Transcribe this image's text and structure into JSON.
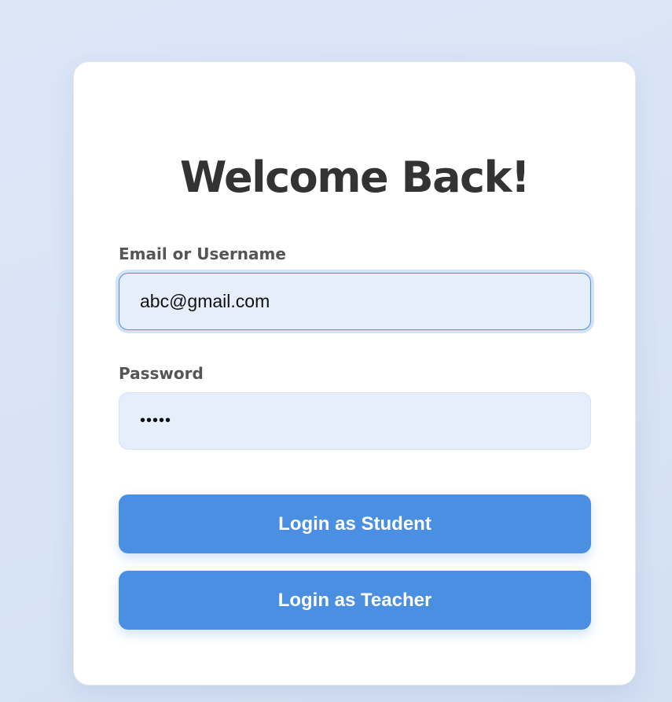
{
  "login": {
    "title": "Welcome Back!",
    "email_label": "Email or Username",
    "email_value": "abc@gmail.com",
    "password_label": "Password",
    "password_value": "•••••",
    "student_button": "Login as Student",
    "teacher_button": "Login as Teacher"
  },
  "colors": {
    "background": "#d9e5f7",
    "card": "#ffffff",
    "input_background": "#e7eefb",
    "input_focus_border": "#4a8fe2",
    "button": "#4a8fe2",
    "button_text": "#ffffff",
    "title_text": "#333333",
    "label_text": "#555555"
  }
}
